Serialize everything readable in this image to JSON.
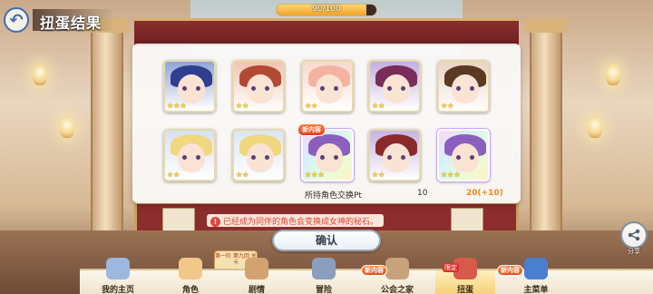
{
  "header": {
    "title": "扭蛋结果",
    "stamina_text": "90/100",
    "stamina_fraction": 0.9
  },
  "result": {
    "cards_row1": [
      {
        "hair": "#2f3e8f",
        "bg": "#8fa6d8",
        "stars": "★★★"
      },
      {
        "hair": "#b24a33",
        "bg": "#f2c4b0",
        "stars": "★★"
      },
      {
        "hair": "#f4b3a1",
        "bg": "#f8d8d0",
        "stars": "★★"
      },
      {
        "hair": "#7a2d58",
        "bg": "#c3b0e2",
        "stars": "★★"
      },
      {
        "hair": "#5a3a22",
        "bg": "#ead3c6",
        "stars": "★★"
      }
    ],
    "cards_row2": [
      {
        "hair": "#f1d77e",
        "bg": "#d6e2f2",
        "stars": "★★"
      },
      {
        "hair": "#f1d77e",
        "bg": "#d9e6f6",
        "stars": "★★"
      },
      {
        "hair": "#8c5fbf",
        "bg": "#e7def4",
        "stars": "★★★",
        "rainbow": true,
        "new_label": "新内容"
      },
      {
        "hair": "#8a2a2a",
        "bg": "#c7b3e3",
        "stars": "★★"
      },
      {
        "hair": "#8c5fbf",
        "bg": "#e7def4",
        "stars": "★★★",
        "rainbow": true
      }
    ],
    "pt_label": "所持角色交换Pt",
    "pt_value": "10",
    "pt_new_value": "20(+10)",
    "notice": "已经成为同伴的角色会变换成女神的秘石。",
    "confirm_label": "确认"
  },
  "share": {
    "label": "分享"
  },
  "event_badge": "第一阶 第九回 关卡",
  "nav": {
    "items": [
      {
        "label": "我的主页"
      },
      {
        "label": "角色"
      },
      {
        "label": "剧情"
      },
      {
        "label": "冒险"
      },
      {
        "label": "公会之家",
        "badge": "新内容"
      },
      {
        "label": "扭蛋",
        "badge": "限定"
      },
      {
        "label": "主菜单",
        "badge": "新内容"
      }
    ]
  },
  "colors": {
    "accent_blue": "#3d6fb5",
    "notice_red": "#e0463a",
    "pt_orange": "#e98b10"
  }
}
